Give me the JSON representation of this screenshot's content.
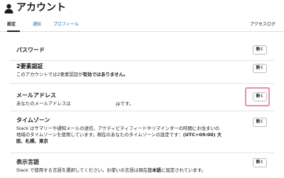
{
  "header": {
    "title": "アカウント"
  },
  "tabs": [
    {
      "label": "設定",
      "active": true
    },
    {
      "label": "通知",
      "active": false
    },
    {
      "label": "プロフィール",
      "active": false
    }
  ],
  "access_log_label": "アクセスログ",
  "sections": {
    "password": {
      "title": "パスワード",
      "button": "開く"
    },
    "two_factor": {
      "title": "2要素認証",
      "desc_prefix": "このアカウントでは2要素認証が",
      "desc_bold": "有効ではありません。",
      "button": "開く"
    },
    "email": {
      "title": "メールアドレス",
      "desc_prefix": "あなたのメールアドレスは",
      "desc_suffix": ".jpです。",
      "button": "開く"
    },
    "timezone": {
      "title": "タイムゾーン",
      "desc_line1": "Slack はサマリーや通知メールの送信、アクティビティフィードやリマインダーの時間にお住まいの",
      "desc_line2_prefix": "地域のタイムゾーンを使用しています。現在のあなたのタイムゾーンの設定です：",
      "desc_line2_bold": "(UTC+09:00) 大",
      "desc_line3_bold": "阪、札幌、東京",
      "button": "開く"
    },
    "language": {
      "title": "表示言語",
      "desc_prefix": "Slack で使用する言語を選択してください。お使いの言語は現在",
      "desc_bold": "日本語",
      "desc_suffix": "に設定されています。",
      "button": "開く"
    }
  },
  "colors": {
    "link": "#1264a3",
    "highlight": "#e98bab"
  }
}
